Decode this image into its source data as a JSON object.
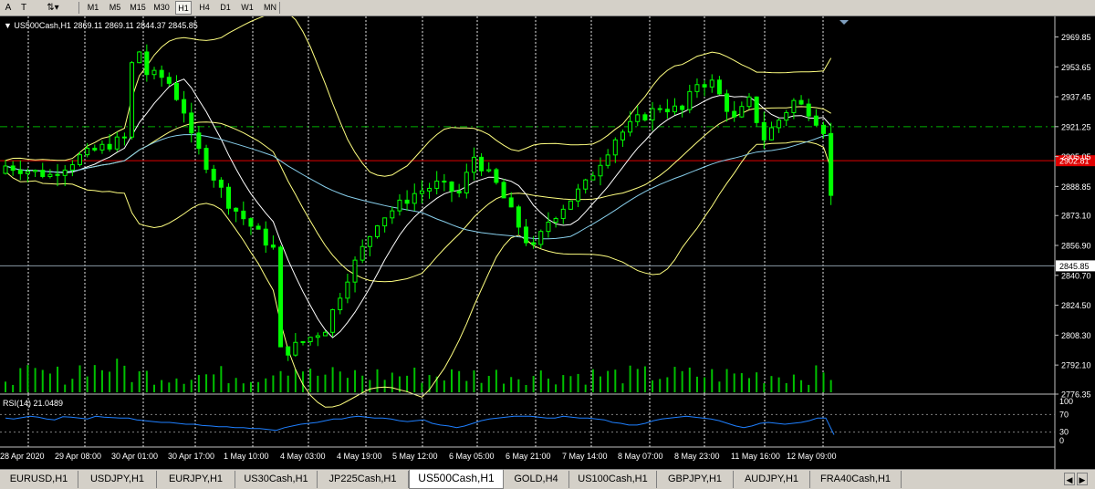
{
  "toolbar": {
    "tools": [
      {
        "name": "text-tool-icon",
        "glyph": "A"
      },
      {
        "name": "text-label-tool-icon",
        "glyph": "T"
      },
      {
        "name": "arrows-tool-icon",
        "glyph": "⇅▾"
      }
    ],
    "timeframes": [
      "M1",
      "M5",
      "M15",
      "M30",
      "H1",
      "H4",
      "D1",
      "W1",
      "MN"
    ],
    "active_timeframe": "H1"
  },
  "chart": {
    "info": "▼ US500Cash,H1  2869.11 2869.11 2844.37 2845.85",
    "price_axis": [
      "2969.85",
      "2953.65",
      "2937.45",
      "2921.25",
      "2905.05",
      "2888.85",
      "2873.10",
      "2856.90",
      "2840.70",
      "2824.50",
      "2808.30",
      "2792.10",
      "2776.35"
    ],
    "price_range": [
      2776.35,
      2978.0
    ],
    "bid_price": "2845.85",
    "red_level": "2902.81",
    "green_level": 2921.25,
    "colors": {
      "bull": "#00ff00",
      "red_line": "#e00000",
      "green_line": "#00b000",
      "price_line": "#8a9aa6",
      "bands": "#ffff80",
      "ma_fast": "#ffffff",
      "ma_slow": "#87ceeb",
      "rsi": "#1e7fff"
    },
    "time_axis": [
      "28 Apr 2020",
      "29 Apr 08:00",
      "30 Apr 01:00",
      "30 Apr 17:00",
      "1 May 10:00",
      "4 May 03:00",
      "4 May 19:00",
      "5 May 12:00",
      "6 May 05:00",
      "6 May 21:00",
      "7 May 14:00",
      "8 May 07:00",
      "8 May 23:00",
      "11 May 16:00",
      "12 May 09:00"
    ]
  },
  "rsi": {
    "info": "RSI(14) 21.0489",
    "levels": [
      "100",
      "70",
      "30",
      "0"
    ],
    "values": [
      62,
      60,
      63,
      66,
      64,
      60,
      58,
      65,
      64,
      62,
      60,
      66,
      64,
      63,
      62,
      62,
      58,
      56,
      54,
      52,
      52,
      50,
      48,
      48,
      45,
      44,
      42,
      42,
      40,
      40,
      38,
      38,
      36,
      34,
      40,
      44,
      48,
      50,
      52,
      56,
      60,
      60,
      64,
      66,
      64,
      62,
      62,
      60,
      56,
      54,
      56,
      58,
      50,
      46,
      44,
      40,
      44,
      50,
      56,
      60,
      62,
      64,
      66,
      66,
      66,
      64,
      62,
      62,
      66,
      64,
      62,
      62,
      60,
      58,
      52,
      50,
      46,
      46,
      50,
      56,
      60,
      62,
      64,
      66,
      64,
      62,
      60,
      56,
      50,
      44,
      40,
      44,
      50,
      52,
      50,
      48,
      50,
      52,
      56,
      62,
      62,
      24
    ]
  },
  "tabs": [
    "EURUSD,H1",
    "USDJPY,H1",
    "EURJPY,H1",
    "US30Cash,H1",
    "JP225Cash,H1",
    "US500Cash,H1",
    "GOLD,H4",
    "US100Cash,H1",
    "GBPJPY,H1",
    "AUDJPY,H1",
    "FRA40Cash,H1"
  ],
  "active_tab": "US500Cash,H1",
  "tab_nav": {
    "left": "◀",
    "right": "▶"
  }
}
